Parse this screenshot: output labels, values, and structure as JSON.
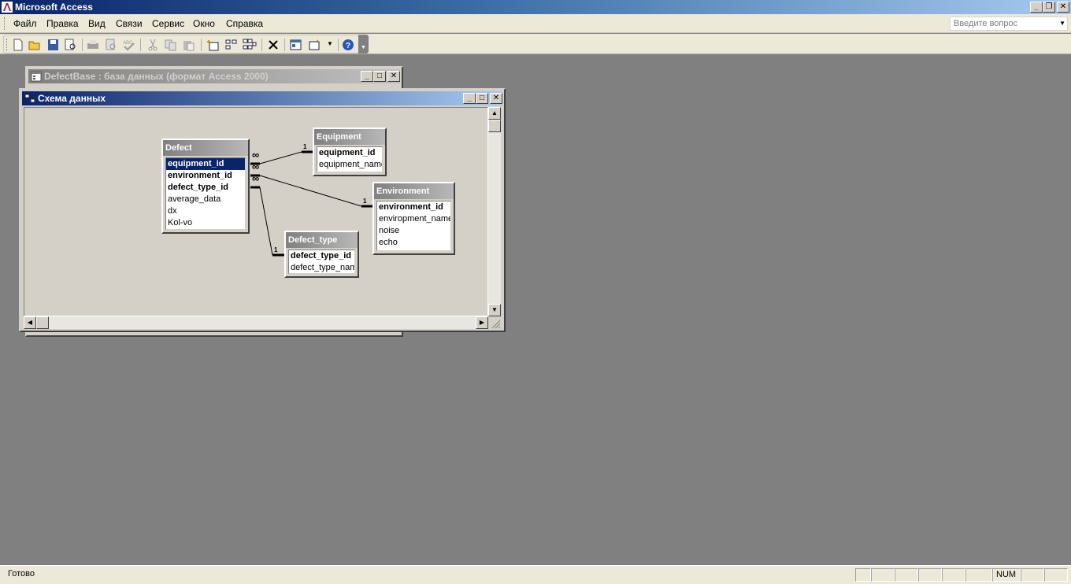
{
  "app": {
    "title": "Microsoft Access",
    "colors": {
      "titlebar": "#0a246a",
      "workspace": "#808080",
      "selection": "#0a246a"
    }
  },
  "menu": {
    "items": [
      "Файл",
      "Правка",
      "Вид",
      "Связи",
      "Сервис",
      "Окно",
      "Справка"
    ],
    "help_placeholder": "Введите вопрос"
  },
  "toolbar": {
    "icons": [
      "new-icon",
      "open-icon",
      "save-icon",
      "search-icon",
      "print-icon",
      "print-preview-icon",
      "spelling-icon",
      "cut-icon",
      "copy-icon",
      "paste-icon",
      "show-table-icon",
      "show-direct-icon",
      "show-all-icon",
      "delete-icon",
      "database-window-icon",
      "new-object-icon",
      "help-icon"
    ]
  },
  "db_window": {
    "title": "DefectBase : база данных (формат Access 2000)"
  },
  "rel_window": {
    "title": "Схема данных"
  },
  "tables": {
    "defect": {
      "name": "Defect",
      "fields": [
        "equipment_id",
        "environment_id",
        "defect_type_id",
        "average_data",
        "dx",
        "Kol-vo"
      ]
    },
    "equipment": {
      "name": "Equipment",
      "fields": [
        "equipment_id",
        "equipment_name"
      ]
    },
    "environment": {
      "name": "Environment",
      "fields": [
        "environment_id",
        "enviropment_name",
        "noise",
        "echo"
      ]
    },
    "defect_type": {
      "name": "Defect_type",
      "fields": [
        "defect_type_id",
        "defect_type_name"
      ]
    }
  },
  "relations": {
    "one_label": "1",
    "many_label": "∞"
  },
  "status": {
    "text": "Готово",
    "num": "NUM"
  }
}
